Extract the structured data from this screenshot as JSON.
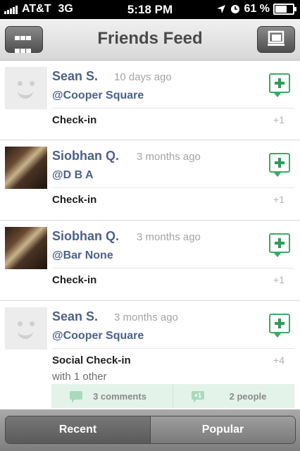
{
  "status": {
    "carrier": "AT&T",
    "network": "3G",
    "time": "5:18 PM",
    "battery": "61 %",
    "battery_level": 0.61
  },
  "nav": {
    "title": "Friends Feed",
    "left_icon": "grid-icon",
    "right_icon": "check-in-icon"
  },
  "feed": [
    {
      "name": "Sean S.",
      "time": "10 days ago",
      "venue": "@Cooper Square",
      "type": "Check-in",
      "plus": "+1",
      "avatar": "default-avatar"
    },
    {
      "name": "Siobhan Q.",
      "time": "3 months ago",
      "venue": "@D B A",
      "type": "Check-in",
      "plus": "+1",
      "avatar": "photo-avatar"
    },
    {
      "name": "Siobhan Q.",
      "time": "3 months ago",
      "venue": "@Bar None",
      "type": "Check-in",
      "plus": "+1",
      "avatar": "photo-avatar"
    },
    {
      "name": "Sean S.",
      "time": "3 months ago",
      "venue": "@Cooper Square",
      "type": "Social Check-in",
      "with": "with 1 other",
      "plus": "+4",
      "comments": "3 comments",
      "people": "2 people",
      "people_badge": "+1",
      "avatar": "default-avatar"
    }
  ],
  "tabs": {
    "recent": "Recent",
    "popular": "Popular"
  },
  "colors": {
    "name": "#4d6188",
    "accent_green": "#3ea86a"
  }
}
